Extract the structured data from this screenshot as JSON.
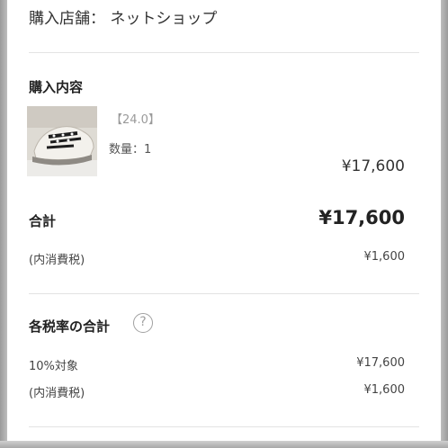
{
  "store": {
    "label": "購入店舗： ネットショップ"
  },
  "purchase": {
    "section_title": "購入内容",
    "item": {
      "size": "【24.0】",
      "quantity": "数量：1",
      "price": "¥17,600",
      "thumbnail_icon": "sneaker-photo"
    }
  },
  "total": {
    "label": "合計",
    "price": "¥17,600",
    "tax_label": "(内消費税)",
    "tax_value": "¥1,600"
  },
  "tax_rates": {
    "title": "各税率の合計",
    "help_icon": "question-circle-icon",
    "help_glyph": "?",
    "rows": [
      {
        "label": "10%対象",
        "value": "¥17,600"
      },
      {
        "label": "(内消費税)",
        "value": "¥1,600"
      }
    ]
  },
  "colors": {
    "frame": "#a8a8a8",
    "divider": "#e3e3e3",
    "text": "#333333",
    "muted": "#9a9a9a"
  }
}
